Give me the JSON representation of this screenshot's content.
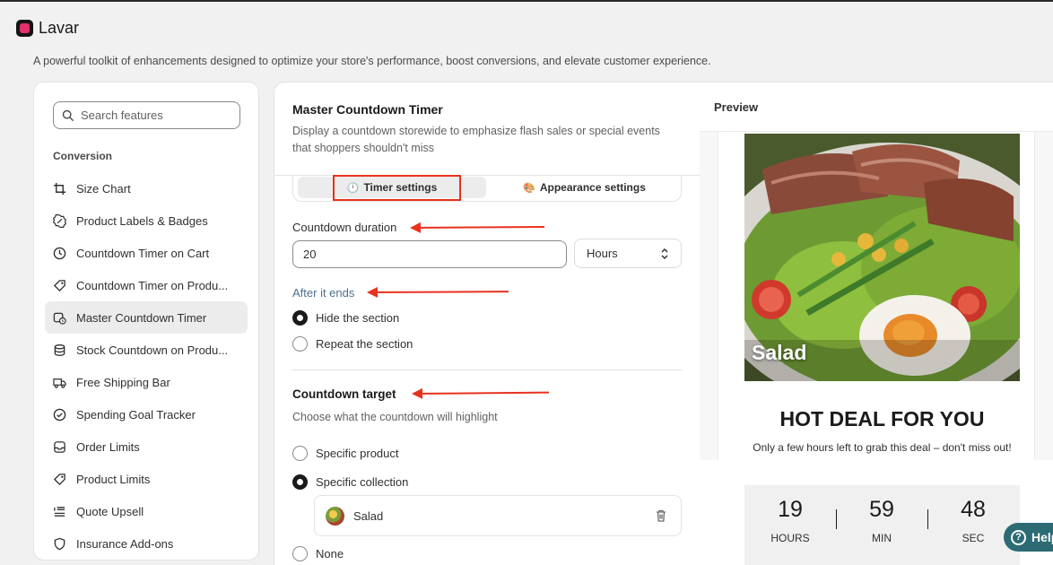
{
  "app": {
    "title": "Lavar",
    "description": "A powerful toolkit of enhancements designed to optimize your store's performance, boost conversions, and elevate customer experience."
  },
  "sidebar": {
    "search_placeholder": "Search features",
    "section": "Conversion",
    "items": [
      {
        "label": "Size Chart",
        "icon": "crop-icon"
      },
      {
        "label": "Product Labels & Badges",
        "icon": "badge-icon"
      },
      {
        "label": "Countdown Timer on Cart",
        "icon": "clock-icon"
      },
      {
        "label": "Countdown Timer on Produ...",
        "icon": "tag-clock-icon"
      },
      {
        "label": "Master Countdown Timer",
        "icon": "calendar-clock-icon",
        "active": true
      },
      {
        "label": "Stock Countdown on Produ...",
        "icon": "database-icon"
      },
      {
        "label": "Free Shipping Bar",
        "icon": "truck-icon"
      },
      {
        "label": "Spending Goal Tracker",
        "icon": "check-circle-icon"
      },
      {
        "label": "Order Limits",
        "icon": "inbox-icon"
      },
      {
        "label": "Product Limits",
        "icon": "tag-icon"
      },
      {
        "label": "Quote Upsell",
        "icon": "list-icon"
      },
      {
        "label": "Insurance Add-ons",
        "icon": "shield-icon"
      }
    ]
  },
  "settings": {
    "title": "Master Countdown Timer",
    "subtitle": "Display a countdown storewide to emphasize flash sales or special events that shoppers shouldn't miss",
    "tabs": [
      {
        "icon": "🕛",
        "label": "Timer settings"
      },
      {
        "icon": "🎨",
        "label": "Appearance settings"
      }
    ],
    "duration_label": "Countdown duration",
    "duration_value": "20",
    "duration_unit": "Hours",
    "after_label": "After it ends",
    "after_options": [
      "Hide the section",
      "Repeat the section"
    ],
    "target_title": "Countdown target",
    "target_sub": "Choose what the countdown will highlight",
    "target_options": [
      "Specific product",
      "Specific collection",
      "None"
    ],
    "collection_name": "Salad"
  },
  "preview": {
    "label": "Preview",
    "image_label": "Salad",
    "deal_title": "HOT DEAL FOR YOU",
    "deal_sub": "Only a few hours left to grab this deal – don't miss out!",
    "timer": [
      {
        "value": "19",
        "unit": "HOURS"
      },
      {
        "value": "59",
        "unit": "MIN"
      },
      {
        "value": "48",
        "unit": "SEC"
      }
    ]
  },
  "help": {
    "label": "Help"
  },
  "colors": {
    "accent_red": "#e8321e",
    "help_teal": "#2c6b74"
  }
}
